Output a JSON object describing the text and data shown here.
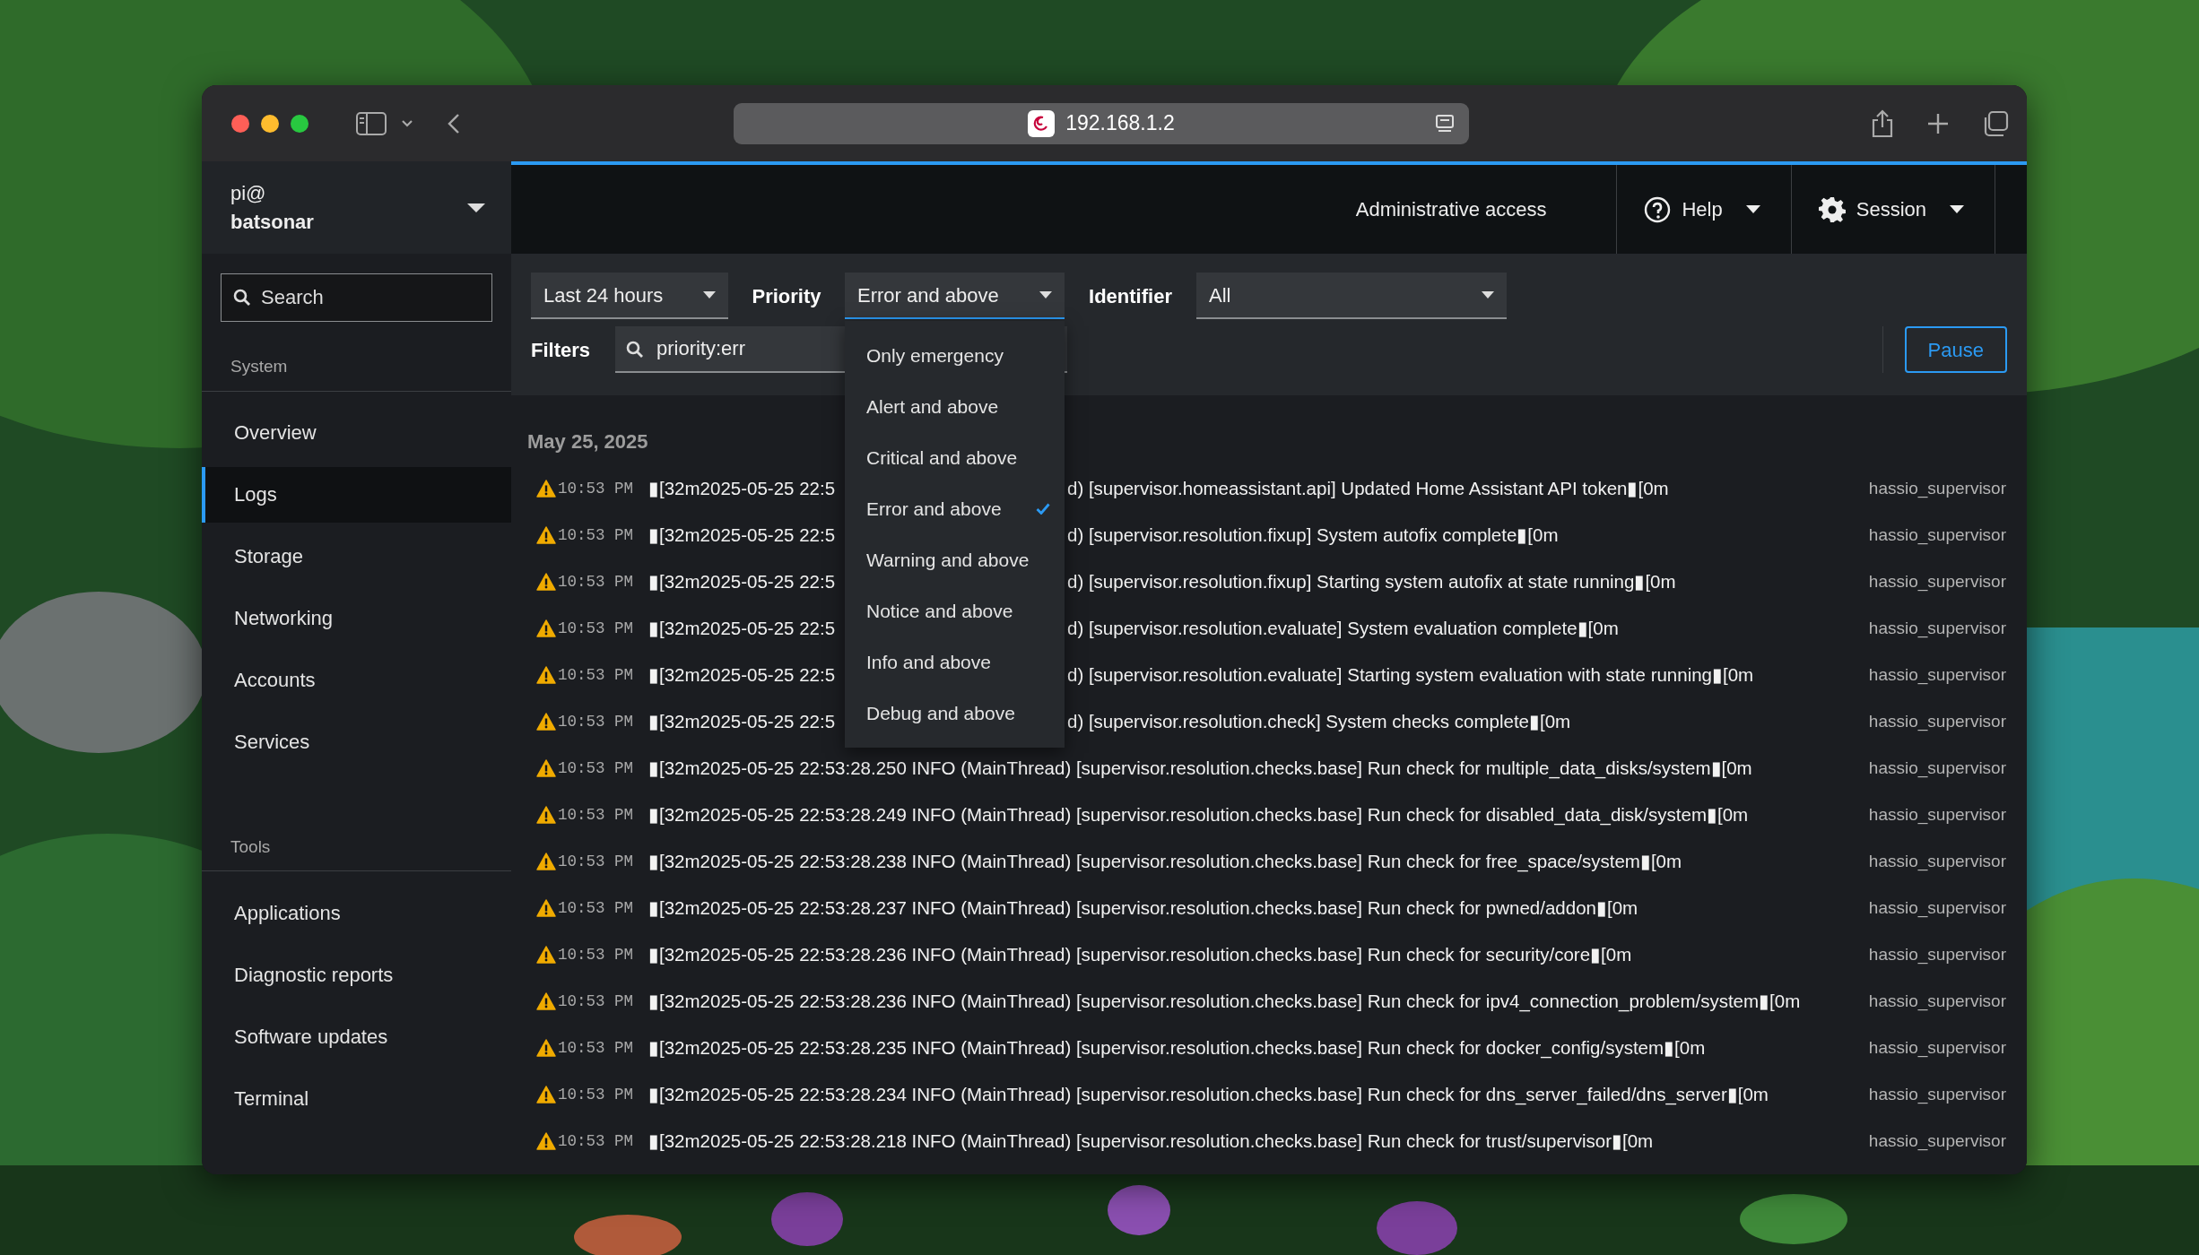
{
  "browser": {
    "address": "192.168.1.2"
  },
  "host": {
    "user": "pi@",
    "name": "batsonar"
  },
  "header": {
    "admin_access": "Administrative access",
    "help": "Help",
    "session": "Session"
  },
  "sidebar": {
    "search": {
      "placeholder": "Search"
    },
    "sections": [
      {
        "title": "System",
        "items": [
          {
            "label": "Overview",
            "selected": false
          },
          {
            "label": "Logs",
            "selected": true
          },
          {
            "label": "Storage",
            "selected": false
          },
          {
            "label": "Networking",
            "selected": false
          },
          {
            "label": "Accounts",
            "selected": false
          },
          {
            "label": "Services",
            "selected": false
          }
        ]
      },
      {
        "title": "Tools",
        "items": [
          {
            "label": "Applications",
            "selected": false
          },
          {
            "label": "Diagnostic reports",
            "selected": false
          },
          {
            "label": "Software updates",
            "selected": false
          },
          {
            "label": "Terminal",
            "selected": false
          }
        ]
      }
    ]
  },
  "toolbar": {
    "time_range": "Last 24 hours",
    "priority_label": "Priority",
    "priority": "Error and above",
    "identifier_label": "Identifier",
    "identifier": "All",
    "filters_label": "Filters",
    "filter": "priority:err",
    "pause": "Pause"
  },
  "priority_menu": {
    "items": [
      {
        "label": "Only emergency",
        "selected": false
      },
      {
        "label": "Alert and above",
        "selected": false
      },
      {
        "label": "Critical and above",
        "selected": false
      },
      {
        "label": "Error and above",
        "selected": true
      },
      {
        "label": "Warning and above",
        "selected": false
      },
      {
        "label": "Notice and above",
        "selected": false
      },
      {
        "label": "Info and above",
        "selected": false
      },
      {
        "label": "Debug and above",
        "selected": false
      }
    ]
  },
  "log": {
    "date": "May 25, 2025",
    "entries": [
      {
        "time": "10:53 PM",
        "message": "▮[32m2025-05-25 22:5",
        "message_end": "d) [supervisor.homeassistant.api] Updated Home Assistant API token▮[0m",
        "identifier": "hassio_supervisor"
      },
      {
        "time": "10:53 PM",
        "message": "▮[32m2025-05-25 22:5",
        "message_end": "d) [supervisor.resolution.fixup] System autofix complete▮[0m",
        "identifier": "hassio_supervisor"
      },
      {
        "time": "10:53 PM",
        "message": "▮[32m2025-05-25 22:5",
        "message_end": "d) [supervisor.resolution.fixup] Starting system autofix at state running▮[0m",
        "identifier": "hassio_supervisor"
      },
      {
        "time": "10:53 PM",
        "message": "▮[32m2025-05-25 22:5",
        "message_end": "d) [supervisor.resolution.evaluate] System evaluation complete▮[0m",
        "identifier": "hassio_supervisor"
      },
      {
        "time": "10:53 PM",
        "message": "▮[32m2025-05-25 22:5",
        "message_end": "d) [supervisor.resolution.evaluate] Starting system evaluation with state running▮[0m",
        "identifier": "hassio_supervisor"
      },
      {
        "time": "10:53 PM",
        "message": "▮[32m2025-05-25 22:5",
        "message_end": "d) [supervisor.resolution.check] System checks complete▮[0m",
        "identifier": "hassio_supervisor"
      },
      {
        "time": "10:53 PM",
        "message": "▮[32m2025-05-25 22:53:28.250 INFO (MainThread) [supervisor.resolution.checks.base] Run check for multiple_data_disks/system▮[0m",
        "identifier": "hassio_supervisor"
      },
      {
        "time": "10:53 PM",
        "message": "▮[32m2025-05-25 22:53:28.249 INFO (MainThread) [supervisor.resolution.checks.base] Run check for disabled_data_disk/system▮[0m",
        "identifier": "hassio_supervisor"
      },
      {
        "time": "10:53 PM",
        "message": "▮[32m2025-05-25 22:53:28.238 INFO (MainThread) [supervisor.resolution.checks.base] Run check for free_space/system▮[0m",
        "identifier": "hassio_supervisor"
      },
      {
        "time": "10:53 PM",
        "message": "▮[32m2025-05-25 22:53:28.237 INFO (MainThread) [supervisor.resolution.checks.base] Run check for pwned/addon▮[0m",
        "identifier": "hassio_supervisor"
      },
      {
        "time": "10:53 PM",
        "message": "▮[32m2025-05-25 22:53:28.236 INFO (MainThread) [supervisor.resolution.checks.base] Run check for security/core▮[0m",
        "identifier": "hassio_supervisor"
      },
      {
        "time": "10:53 PM",
        "message": "▮[32m2025-05-25 22:53:28.236 INFO (MainThread) [supervisor.resolution.checks.base] Run check for ipv4_connection_problem/system▮[0m",
        "identifier": "hassio_supervisor"
      },
      {
        "time": "10:53 PM",
        "message": "▮[32m2025-05-25 22:53:28.235 INFO (MainThread) [supervisor.resolution.checks.base] Run check for docker_config/system▮[0m",
        "identifier": "hassio_supervisor"
      },
      {
        "time": "10:53 PM",
        "message": "▮[32m2025-05-25 22:53:28.234 INFO (MainThread) [supervisor.resolution.checks.base] Run check for dns_server_failed/dns_server▮[0m",
        "identifier": "hassio_supervisor"
      },
      {
        "time": "10:53 PM",
        "message": "▮[32m2025-05-25 22:53:28.218 INFO (MainThread) [supervisor.resolution.checks.base] Run check for trust/supervisor▮[0m",
        "identifier": "hassio_supervisor"
      }
    ]
  }
}
